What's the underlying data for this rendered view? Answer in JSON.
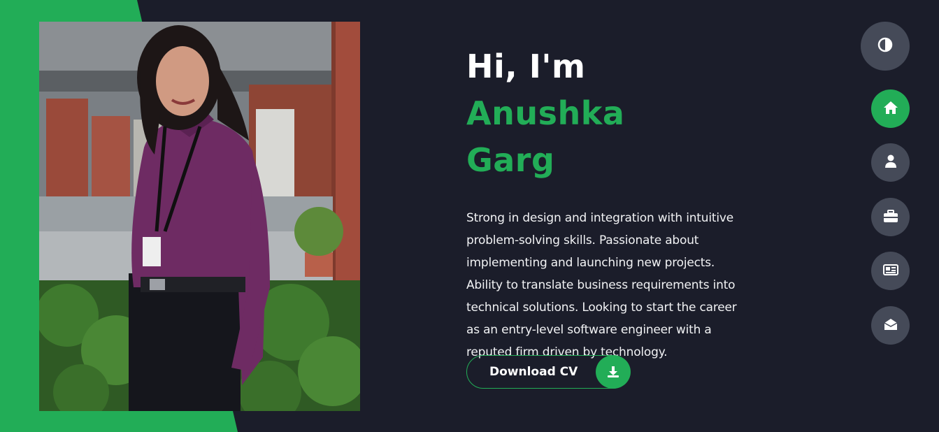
{
  "hero": {
    "greeting": "Hi, I'm",
    "name_line1": "Anushka",
    "name_line2": "Garg",
    "bio": "Strong in design and integration with intuitive problem-solving skills. Passionate about implementing and launching new projects. Ability to translate business requirements into technical solutions. Looking to start the career as an entry-level software engineer with a reputed firm driven by technology.",
    "cv_button_label": "Download CV"
  },
  "nav": {
    "theme_icon": "contrast-icon",
    "items": [
      {
        "icon": "home-icon",
        "active": true
      },
      {
        "icon": "user-icon",
        "active": false
      },
      {
        "icon": "briefcase-icon",
        "active": false
      },
      {
        "icon": "newspaper-icon",
        "active": false
      },
      {
        "icon": "envelope-open-icon",
        "active": false
      }
    ]
  },
  "colors": {
    "accent": "#22ad57",
    "background": "#1b1d2a",
    "nav_button": "#454a58"
  }
}
